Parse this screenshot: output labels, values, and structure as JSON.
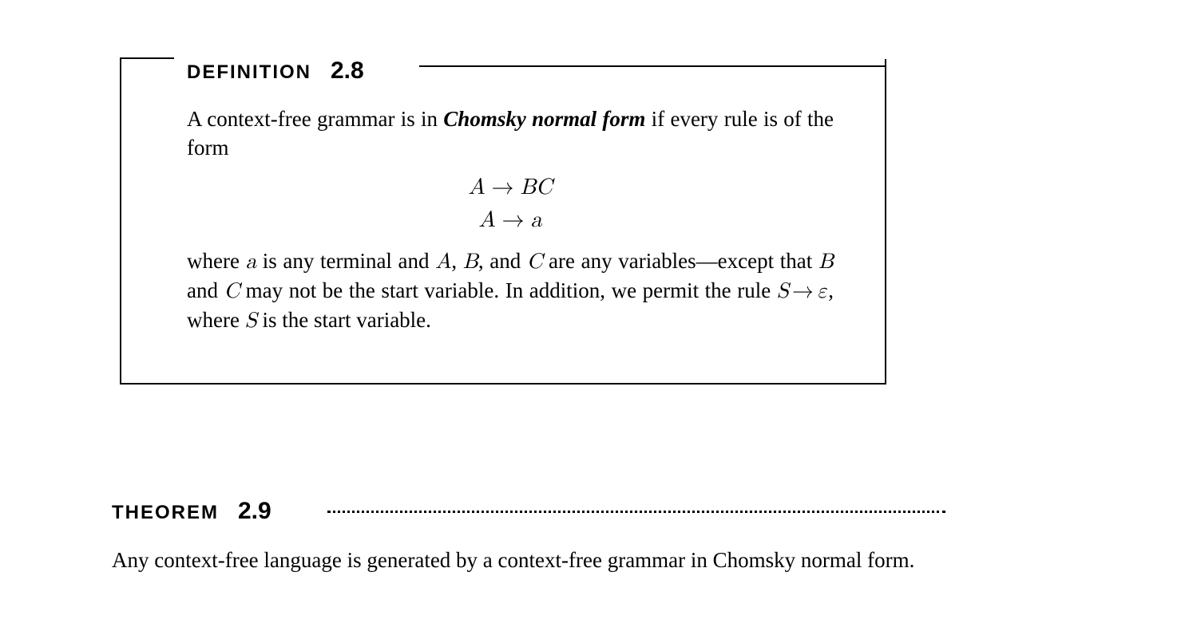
{
  "definition": {
    "label": "DEFINITION",
    "number": "2.8",
    "intro_pre": "A context-free grammar is in ",
    "term": "Chomsky normal form",
    "intro_post": " if every rule is of the form",
    "rule1_lhs": "A",
    "rule1_rhs": "BC",
    "rule2_lhs": "A",
    "rule2_rhs": "a",
    "arrow": "→",
    "tail_1": "where ",
    "a": "a",
    "tail_2": " is any terminal and ",
    "A": "A",
    "tail_3": ", ",
    "B": "B",
    "tail_4": ", and ",
    "C": "C",
    "tail_5": " are any variables—except that ",
    "B2": "B",
    "tail_6": " and ",
    "C2": "C",
    "tail_7": " may not be the start variable. In addition, we permit the rule ",
    "S": "S",
    "eps": "ε",
    "tail_8": ", where ",
    "S2": "S",
    "tail_9": " is the start variable."
  },
  "theorem": {
    "label": "THEOREM",
    "number": "2.9",
    "statement": "Any context-free language is generated by a context-free grammar in Chomsky normal form."
  }
}
